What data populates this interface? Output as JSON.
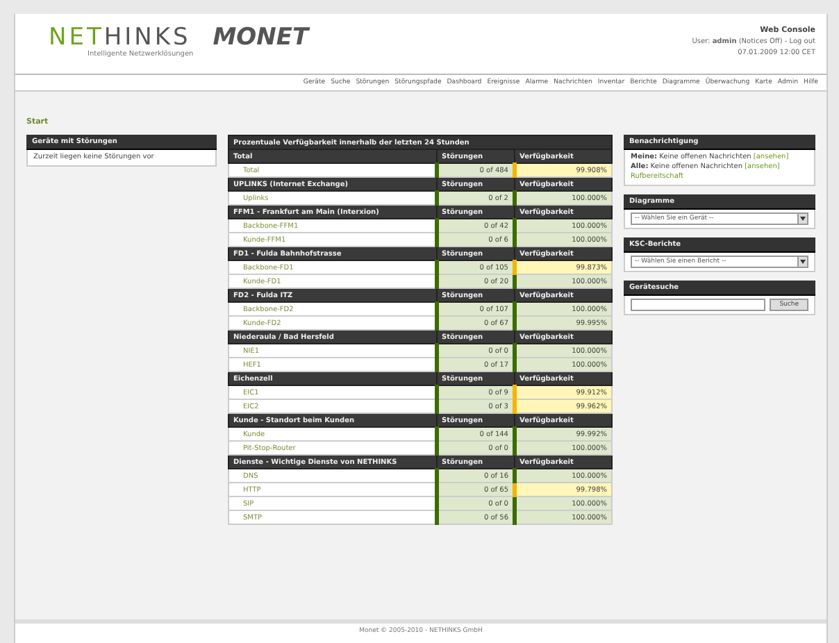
{
  "header": {
    "logo_accent": "NET",
    "logo_rest": "HINKS",
    "tagline": "Intelligente Netzwerklösungen",
    "product": "MONET",
    "console": "Web Console",
    "user_label": "User:",
    "user": "admin",
    "notices": "(Notices Off) -",
    "logout": "Log out",
    "datetime": "07.01.2009   12:00 CET"
  },
  "nav": [
    "Geräte",
    "Suche",
    "Störungen",
    "Störungspfade",
    "Dashboard",
    "Ereignisse",
    "Alarme",
    "Nachrichten",
    "Inventar",
    "Berichte",
    "Diagramme",
    "Überwachung",
    "Karte",
    "Admin",
    "Hilfe"
  ],
  "breadcrumb": "Start",
  "left_panel": {
    "title": "Geräte mit Störungen",
    "text": "Zurzeit liegen keine Störungen vor"
  },
  "table": {
    "title": "Prozentuale Verfügbarkeit innerhalb der letzten 24 Stunden",
    "groups": [
      {
        "name": "Total",
        "col_1": "Störungen",
        "col_2": "Verfügbarkeit",
        "rows": [
          {
            "name": "Total",
            "outages": "0 of 484",
            "availability": "99.908%",
            "below_target": true
          }
        ]
      },
      {
        "name": "UPLINKS (Internet Exchange)",
        "col_1": "Störungen",
        "col_2": "Verfügbarkeit",
        "rows": [
          {
            "name": "Uplinks",
            "outages": "0 of 2",
            "availability": "100.000%",
            "below_target": false
          }
        ]
      },
      {
        "name": "FFM1 - Frankfurt am Main (Interxion)",
        "col_1": "Störungen",
        "col_2": "Verfügbarkeit",
        "rows": [
          {
            "name": "Backbone-FFM1",
            "outages": "0 of 42",
            "availability": "100.000%",
            "below_target": false
          },
          {
            "name": "Kunde-FFM1",
            "outages": "0 of 6",
            "availability": "100.000%",
            "below_target": false
          }
        ]
      },
      {
        "name": "FD1 - Fulda Bahnhofstrasse",
        "col_1": "Störungen",
        "col_2": "Verfügbarkeit",
        "rows": [
          {
            "name": "Backbone-FD1",
            "outages": "0 of 105",
            "availability": "99.873%",
            "below_target": true
          },
          {
            "name": "Kunde-FD1",
            "outages": "0 of 20",
            "availability": "100.000%",
            "below_target": false
          }
        ]
      },
      {
        "name": "FD2 - Fulda ITZ",
        "col_1": "Störungen",
        "col_2": "Verfügbarkeit",
        "rows": [
          {
            "name": "Backbone-FD2",
            "outages": "0 of 107",
            "availability": "100.000%",
            "below_target": false
          },
          {
            "name": "Kunde-FD2",
            "outages": "0 of 67",
            "availability": "99.995%",
            "below_target": false
          }
        ]
      },
      {
        "name": "Niederaula / Bad Hersfeld",
        "col_1": "Störungen",
        "col_2": "Verfügbarkeit",
        "rows": [
          {
            "name": "NIE1",
            "outages": "0 of 0",
            "availability": "100.000%",
            "below_target": false
          },
          {
            "name": "HEF1",
            "outages": "0 of 17",
            "availability": "100.000%",
            "below_target": false
          }
        ]
      },
      {
        "name": "Eichenzell",
        "col_1": "Störungen",
        "col_2": "Verfügbarkeit",
        "rows": [
          {
            "name": "EIC1",
            "outages": "0 of 9",
            "availability": "99.912%",
            "below_target": true
          },
          {
            "name": "EIC2",
            "outages": "0 of 3",
            "availability": "99.962%",
            "below_target": true
          }
        ]
      },
      {
        "name": "Kunde - Standort beim Kunden",
        "col_1": "Störungen",
        "col_2": "Verfügbarkeit",
        "rows": [
          {
            "name": "Kunde",
            "outages": "0 of 144",
            "availability": "99.992%",
            "below_target": false
          },
          {
            "name": "Pit-Stop-Router",
            "outages": "0 of 0",
            "availability": "100.000%",
            "below_target": false
          }
        ]
      },
      {
        "name": "Dienste - Wichtige Dienste von NETHINKS",
        "col_1": "Störungen",
        "col_2": "Verfügbarkeit",
        "rows": [
          {
            "name": "DNS",
            "outages": "0 of 16",
            "availability": "100.000%",
            "below_target": false
          },
          {
            "name": "HTTP",
            "outages": "0 of 65",
            "availability": "99.798%",
            "below_target": true
          },
          {
            "name": "SIP",
            "outages": "0 of 0",
            "availability": "100.000%",
            "below_target": false
          },
          {
            "name": "SMTP",
            "outages": "0 of 56",
            "availability": "100.000%",
            "below_target": false
          }
        ]
      }
    ]
  },
  "notifications": {
    "title": "Benachrichtigung",
    "lines": [
      {
        "label": "Meine:",
        "text": "Keine offenen Nachrichten",
        "link": "[ansehen]"
      },
      {
        "label": "Alle:",
        "text": "Keine offenen Nachrichten",
        "link": "[ansehen]"
      }
    ],
    "oncall": "Rufbereitschaft"
  },
  "diagrams": {
    "title": "Diagramme",
    "select": "-- Wählen Sie ein Gerät --"
  },
  "reports": {
    "title": "KSC-Berichte",
    "select": "-- Wählen Sie einen Bericht --"
  },
  "device_search": {
    "title": "Gerätesuche",
    "button": "Suche"
  },
  "footer": "Monet © 2005-2010 - NETHINKS GmbH"
}
